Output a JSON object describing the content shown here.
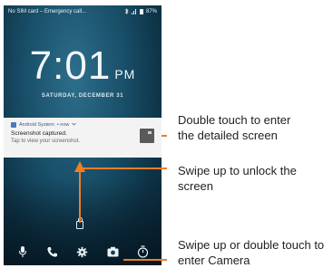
{
  "status_bar": {
    "carrier_text": "No SIM card – Emergency call...",
    "battery_text": "87%"
  },
  "clock": {
    "time": "7:01",
    "ampm": "PM",
    "date": "SATURDAY, DECEMBER 31"
  },
  "notification": {
    "app_name": "Android System",
    "when": "• now",
    "title": "Screenshot captured.",
    "text": "Tap to view your screenshot."
  },
  "bottom_icons": [
    "microphone-icon",
    "phone-icon",
    "settings-icon",
    "camera-icon",
    "timer-icon"
  ],
  "callouts": {
    "notification": "Double touch to enter the detailed screen",
    "unlock": "Swipe up to unlock the screen",
    "camera": "Swipe up or double touch to enter Camera"
  },
  "colors": {
    "accent": "#f07e26",
    "wallpaper": "#184e68",
    "notification_bg": "#f3f3f3"
  }
}
